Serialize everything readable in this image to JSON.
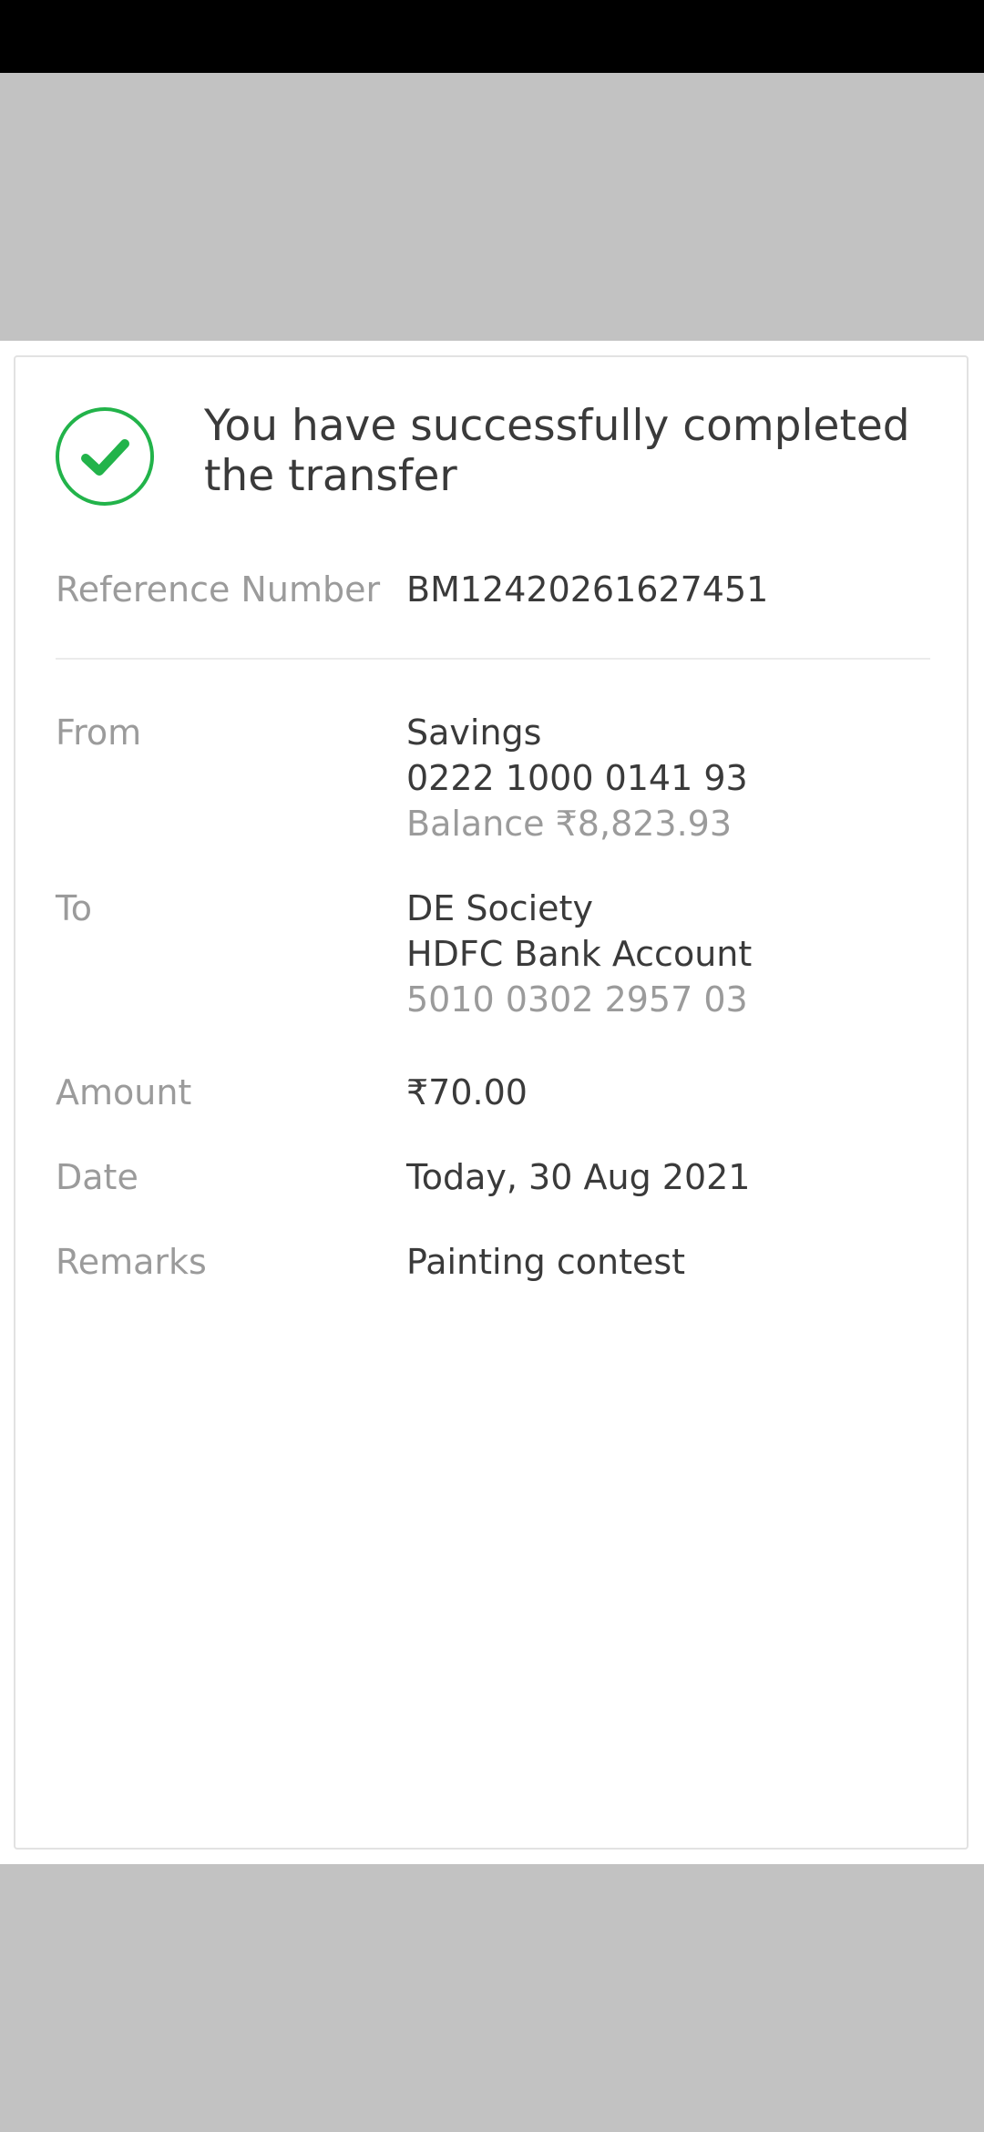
{
  "confirmation": {
    "title": "You have successfully completed the transfer",
    "reference": {
      "label": "Reference Number",
      "value": "BM12420261627451"
    },
    "from": {
      "label": "From",
      "account_type": "Savings",
      "account_number": "0222 1000 0141 93",
      "balance": "Balance ₹8,823.93"
    },
    "to": {
      "label": "To",
      "payee_name": "DE Society",
      "bank_account": "HDFC Bank Account",
      "account_number": "5010 0302 2957 03"
    },
    "amount": {
      "label": "Amount",
      "value": "₹70.00"
    },
    "date": {
      "label": "Date",
      "value": "Today, 30 Aug 2021"
    },
    "remarks": {
      "label": "Remarks",
      "value": "Painting contest"
    }
  },
  "colors": {
    "success_green": "#22b34a",
    "text_primary": "#3a3a3a",
    "text_secondary": "#9b9b9b",
    "scrim": "#c2c2c2"
  },
  "icons": {
    "success": "check-circle-icon"
  }
}
